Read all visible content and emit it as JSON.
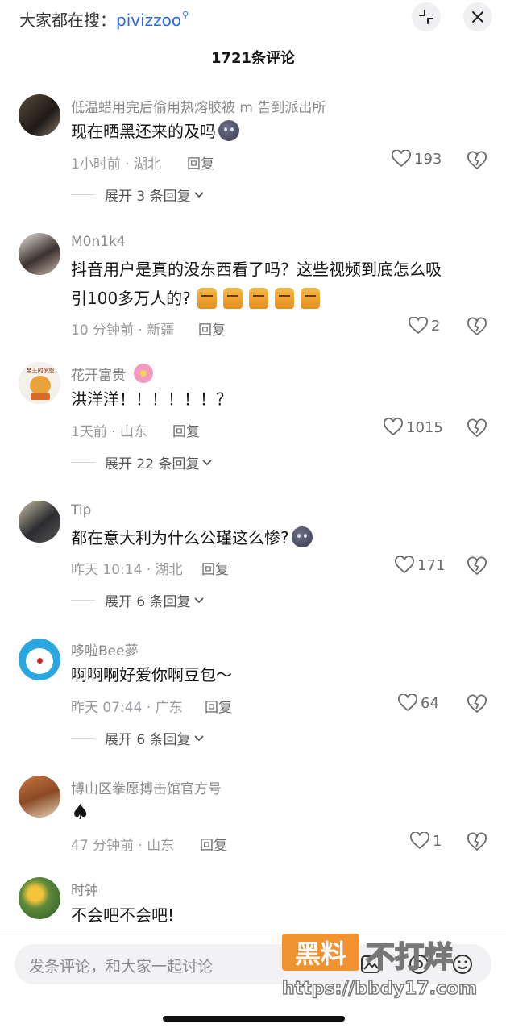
{
  "search": {
    "prefix": "大家都在搜：",
    "keyword": "pivizzoo"
  },
  "header": {
    "count_title": "1721条评论"
  },
  "comments": [
    {
      "user": "低温蜡用完后偷用热熔胶被 m 告到派出所",
      "text": "现在晒黑还来的及吗",
      "time_loc": "1小时前 · 湖北",
      "reply": "回复",
      "likes": "193",
      "expand": "展开 3 条回复"
    },
    {
      "user": "M0n1k4",
      "text_line1": "抖音用户是真的没东西看了吗？这些视频到底怎么吸",
      "text_line2": "引100多万人的?",
      "time_loc": "10 分钟前 · 新疆",
      "reply": "回复",
      "likes": "2"
    },
    {
      "user": "花开富贵",
      "text": "洪洋洋！！！！！！？",
      "time_loc": "1天前 · 山东",
      "reply": "回复",
      "likes": "1015",
      "expand": "展开 22 条回复",
      "avatar_caption": "帝王的愤怒"
    },
    {
      "user": "Tip",
      "text": "都在意大利为什么公瑾这么惨?",
      "time_loc": "昨天 10:14 · 湖北",
      "reply": "回复",
      "likes": "171",
      "expand": "展开 6 条回复"
    },
    {
      "user": "哆啦Bee夢",
      "text": "啊啊啊好爱你啊豆包～",
      "time_loc": "昨天 07:44 · 广东",
      "reply": "回复",
      "likes": "64",
      "expand": "展开 6 条回复"
    },
    {
      "user": "博山区拳愿搏击馆官方号",
      "text": "♠",
      "time_loc": "47 分钟前 · 山东",
      "reply": "回复",
      "likes": "1"
    },
    {
      "user": "时钟",
      "text": "不会吧不会吧!"
    }
  ],
  "composer": {
    "placeholder": "发条评论，和大家一起讨论"
  },
  "watermark": {
    "badge": "黑料",
    "text": "不打烊",
    "url": "https://bbdy17.com"
  },
  "colors": {
    "link": "#2a6cd8",
    "muted": "#8a8a8e",
    "text": "#161616",
    "watermark": "#f08a1f"
  }
}
